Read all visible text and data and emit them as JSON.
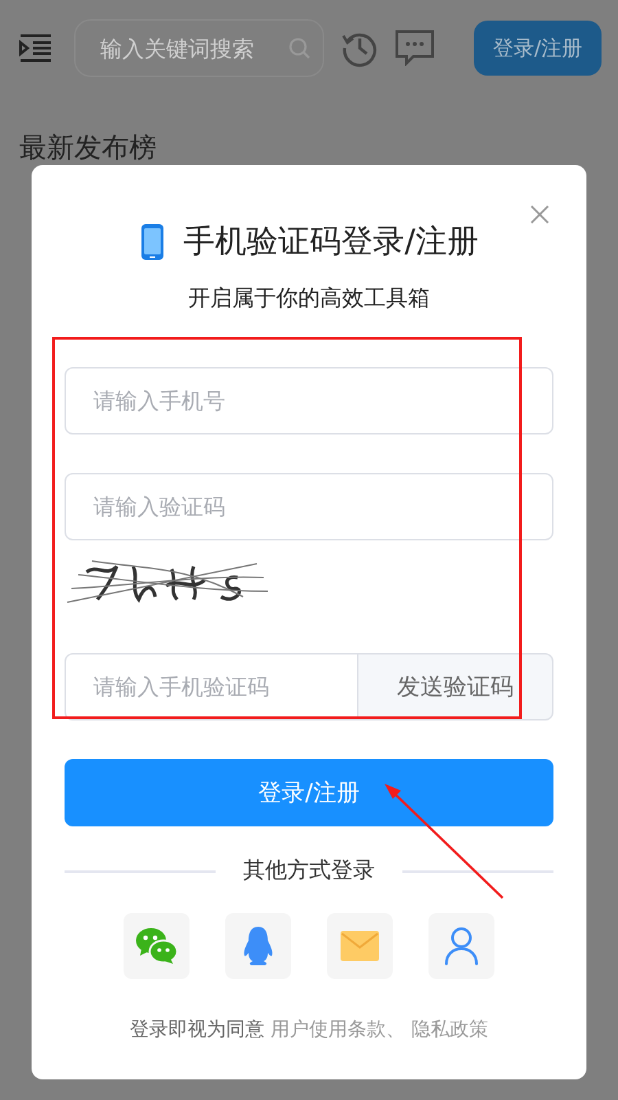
{
  "header": {
    "search": {
      "placeholder": "输入关键词搜索"
    },
    "login_button": "登录/注册"
  },
  "section_title": "最新发布榜",
  "dialog": {
    "title": "手机验证码登录/注册",
    "subtitle": "开启属于你的高效工具箱",
    "fields": [
      {
        "kind": "input",
        "placeholder": "请输入手机号"
      },
      {
        "kind": "input",
        "placeholder": "请输入验证码"
      },
      {
        "kind": "captcha"
      },
      {
        "kind": "sms",
        "placeholder": "请输入手机验证码",
        "button": "发送验证码"
      }
    ],
    "submit": "登录/注册",
    "divider": "其他方式登录",
    "methods": [
      {
        "kind": "wechat"
      },
      {
        "kind": "qq"
      },
      {
        "kind": "mail"
      },
      {
        "kind": "account"
      }
    ],
    "agreement": {
      "prefix": "登录即视为同意",
      "links": [
        "用户使用条款、",
        "隐私政策"
      ]
    }
  }
}
